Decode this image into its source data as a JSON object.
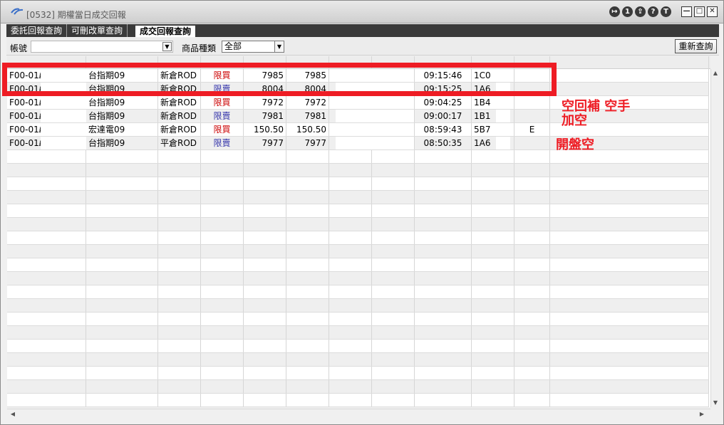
{
  "window": {
    "title": "[0532] 期權當日成交回報",
    "tool_buttons": [
      "↦",
      "1",
      "⇪",
      "?",
      "T"
    ],
    "min_label": "—",
    "max_label": "□",
    "close_label": "✕"
  },
  "tabs": [
    {
      "label": "委託回報查詢",
      "active": false
    },
    {
      "label": "可刪改單查詢",
      "active": false
    },
    {
      "label": "成交回報查詢",
      "active": true
    }
  ],
  "query": {
    "account_label": "帳號",
    "product_label": "商品種類",
    "product_value": "全部",
    "refresh_label": "重新查詢"
  },
  "grid": {
    "rows": [
      {
        "account": "F00-01ℓ",
        "product": "台指期09",
        "position": "新倉ROD",
        "side": "限買",
        "side_color": "#cc0000",
        "price": "7985",
        "fill_price": "7985",
        "time": "09:15:46",
        "order_no": "1C0",
        "flag": ""
      },
      {
        "account": "F00-01ℓ",
        "product": "台指期09",
        "position": "新倉ROD",
        "side": "限賣",
        "side_color": "#3333aa",
        "price": "8004",
        "fill_price": "8004",
        "time": "09:15:25",
        "order_no": "1A6",
        "flag": ""
      },
      {
        "account": "F00-01ℓ",
        "product": "台指期09",
        "position": "新倉ROD",
        "side": "限買",
        "side_color": "#cc0000",
        "price": "7972",
        "fill_price": "7972",
        "time": "09:04:25",
        "order_no": "1B4",
        "flag": ""
      },
      {
        "account": "F00-01ℓ",
        "product": "台指期09",
        "position": "新倉ROD",
        "side": "限賣",
        "side_color": "#3333aa",
        "price": "7981",
        "fill_price": "7981",
        "time": "09:00:17",
        "order_no": "1B1",
        "flag": ""
      },
      {
        "account": "F00-01ℓ",
        "product": "宏達電09",
        "position": "新倉ROD",
        "side": "限買",
        "side_color": "#cc0000",
        "price": "150.50",
        "fill_price": "150.50",
        "time": "08:59:43",
        "order_no": "5B7",
        "flag": "E"
      },
      {
        "account": "F00-01ℓ",
        "product": "台指期09",
        "position": "平倉ROD",
        "side": "限賣",
        "side_color": "#3333aa",
        "price": "7977",
        "fill_price": "7977",
        "time": "08:50:35",
        "order_no": "1A6",
        "flag": ""
      }
    ]
  },
  "annotations": {
    "line1": "空回補 空手",
    "line2": "加空",
    "line3": "開盤空",
    "color": "#ee1c24"
  }
}
